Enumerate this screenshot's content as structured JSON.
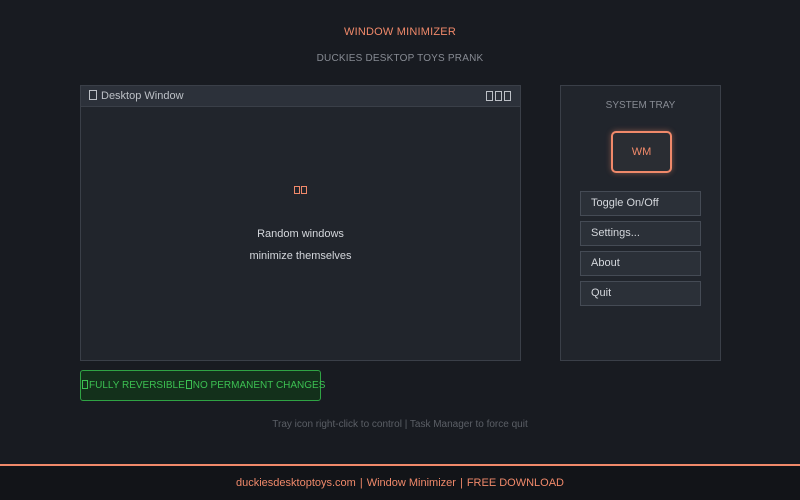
{
  "header": {
    "title": "WINDOW MINIMIZER",
    "subtitle": "DUCKIES DESKTOP TOYS PRANK"
  },
  "desktop_window": {
    "title": "Desktop Window",
    "body_line_1": "Random windows",
    "body_line_2": "minimize themselves"
  },
  "system_tray": {
    "title": "SYSTEM TRAY",
    "icon_label": "WM",
    "menu": [
      {
        "label": "Toggle On/Off"
      },
      {
        "label": "Settings..."
      },
      {
        "label": "About"
      },
      {
        "label": "Quit"
      }
    ]
  },
  "badge": {
    "part_1": "FULLY REVERSIBLE",
    "part_2": "NO PERMANENT CHANGES"
  },
  "hint": "Tray icon right-click to control | Task Manager to force quit",
  "footer": {
    "site": "duckiesdesktoptoys.com",
    "sep": "|",
    "product": "Window Minimizer",
    "cta": "FREE DOWNLOAD"
  },
  "colors": {
    "accent": "#f0896a",
    "success": "#3cc052",
    "background": "#181b21",
    "panel": "#21252c"
  }
}
